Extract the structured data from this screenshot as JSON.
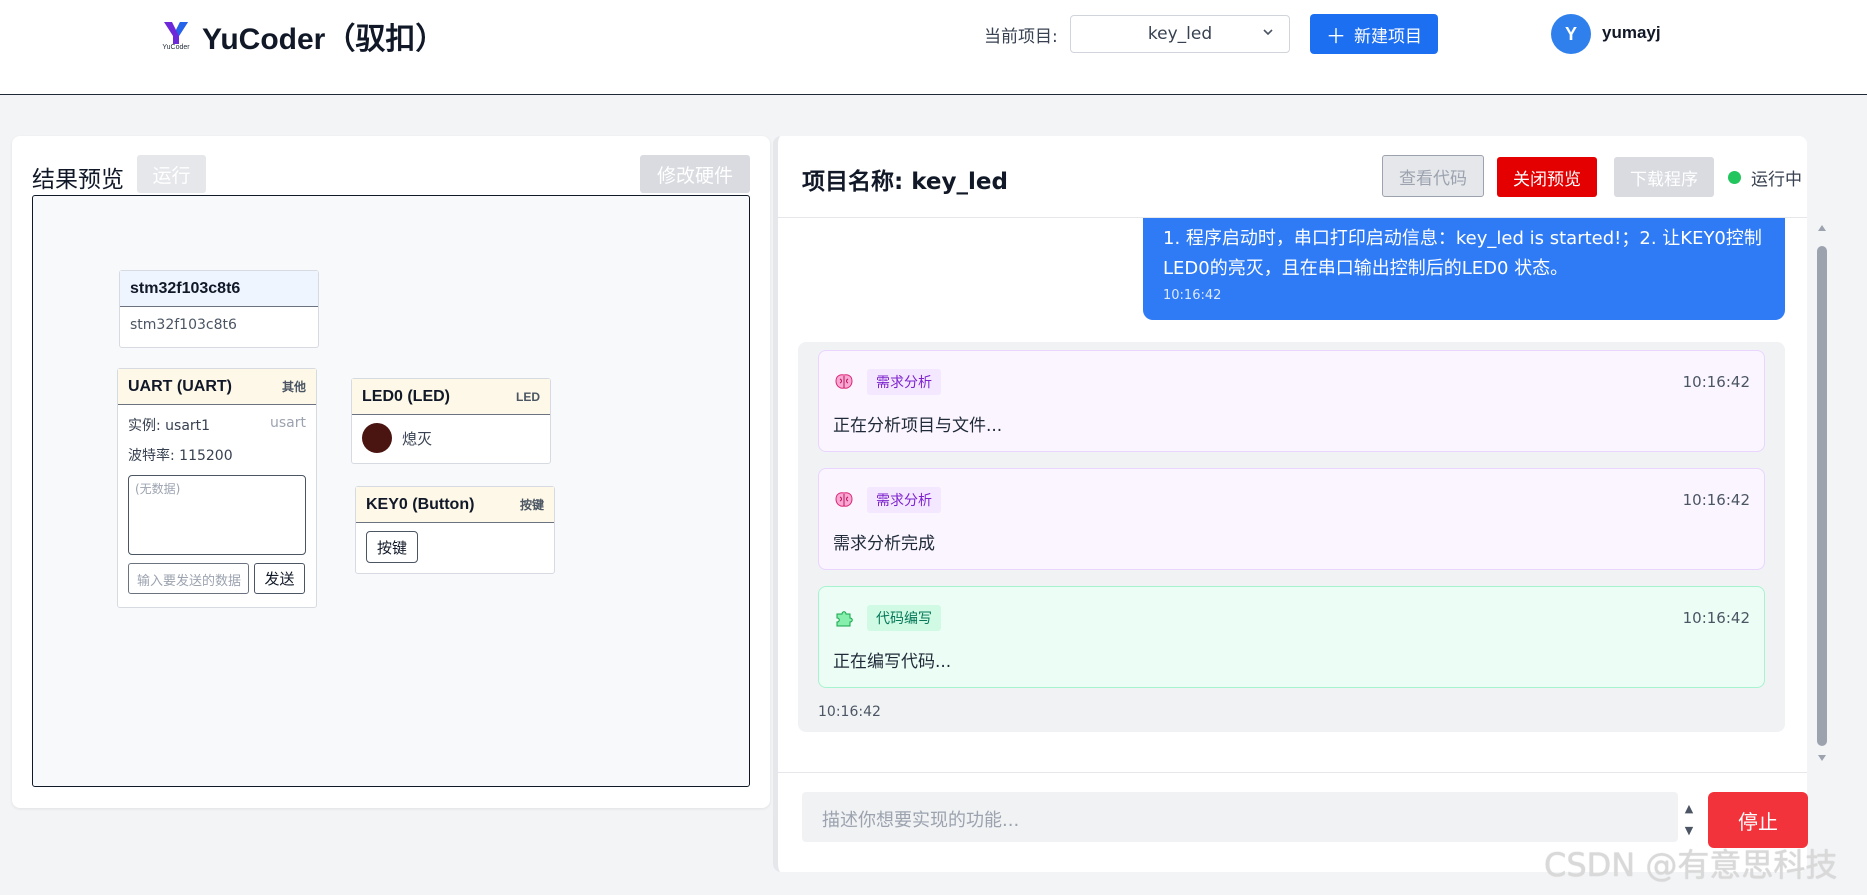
{
  "header": {
    "app_title": "YuCoder（驭扣）",
    "logo_text": "YuCoder",
    "project_label": "当前项目:",
    "project_value": "key_led",
    "new_project_label": "新建项目",
    "user_initial": "Y",
    "username": "yumayj"
  },
  "left": {
    "title": "结果预览",
    "run_label": "运行",
    "edit_hw_label": "修改硬件",
    "mcu": {
      "name": "stm32f103c8t6",
      "body": "stm32f103c8t6"
    },
    "uart": {
      "name": "UART (UART)",
      "tag": "其他",
      "instance": "实例: usart1",
      "instance_type": "usart",
      "baud": "波特率: 115200",
      "output_placeholder": "(无数据)",
      "send_placeholder": "输入要发送的数据",
      "send_label": "发送"
    },
    "led": {
      "name": "LED0 (LED)",
      "tag": "LED",
      "state": "熄灭"
    },
    "key": {
      "name": "KEY0 (Button)",
      "tag": "按键",
      "button_label": "按键"
    }
  },
  "right": {
    "title": "项目名称: key_led",
    "view_code_label": "查看代码",
    "close_preview_label": "关闭预览",
    "download_label": "下载程序",
    "status_label": "运行中",
    "user_message": {
      "text": "1. 程序启动时，串口打印启动信息：key_led is started!；2. 让KEY0控制LED0的亮灭，且在串口输出控制后的LED0 状态。",
      "time": "10:16:42"
    },
    "steps": [
      {
        "icon": "brain-icon",
        "tag": "需求分析",
        "time": "10:16:42",
        "text": "正在分析项目与文件..."
      },
      {
        "icon": "brain-icon",
        "tag": "需求分析",
        "time": "10:16:42",
        "text": "需求分析完成"
      },
      {
        "icon": "puzzle-icon",
        "tag": "代码编写",
        "time": "10:16:42",
        "text": "正在编写代码..."
      }
    ],
    "ai_time": "10:16:42",
    "input_placeholder": "描述你想要实现的功能...",
    "stop_label": "停止"
  },
  "watermark": "CSDN @有意思科技",
  "colors": {
    "primary": "#1d6ff2",
    "danger": "#e40000",
    "stop": "#f2333b",
    "status_ok": "#22c55e",
    "led_off": "#4a1411"
  }
}
